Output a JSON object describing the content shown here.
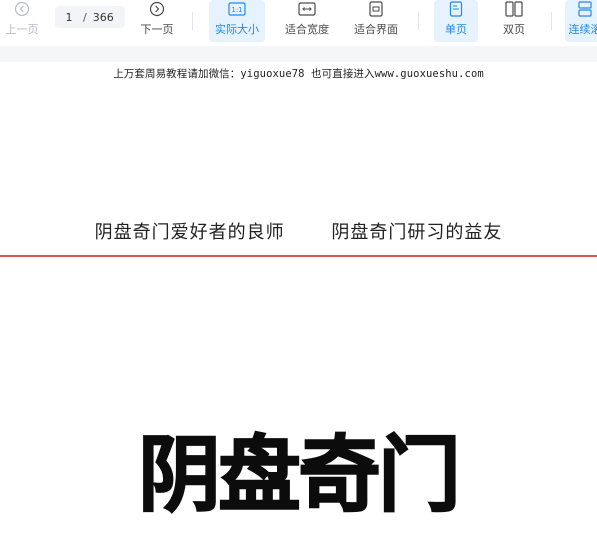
{
  "toolbar": {
    "prev": {
      "label": "上一页",
      "icon": "chevron-left-circle-icon"
    },
    "pager": {
      "current": "1",
      "separator": "/",
      "total": "366"
    },
    "next": {
      "label": "下一页",
      "icon": "chevron-right-circle-icon"
    },
    "actual_size": {
      "label": "实际大小",
      "icon_text": "1:1"
    },
    "fit_width": {
      "label": "适合宽度",
      "icon": "fit-width-icon"
    },
    "fit_page": {
      "label": "适合界面",
      "icon": "fit-page-icon"
    },
    "single_page": {
      "label": "单页",
      "icon": "single-page-icon"
    },
    "double_page": {
      "label": "双页",
      "icon": "double-page-icon"
    },
    "continuous": {
      "label": "连续滚",
      "icon": "continuous-scroll-icon"
    },
    "accent_color": "#1f8ae8",
    "active_bg": "#e6f2fd"
  },
  "document": {
    "header_note": "上万套周易教程请加微信：yiguoxue78  也可直接进入www.guoxueshu.com",
    "motto_left": "阴盘奇门爱好者的良师",
    "motto_right": "阴盘奇门研习的益友",
    "rule_color": "#d45a56",
    "big_title": "阴盘奇门"
  }
}
